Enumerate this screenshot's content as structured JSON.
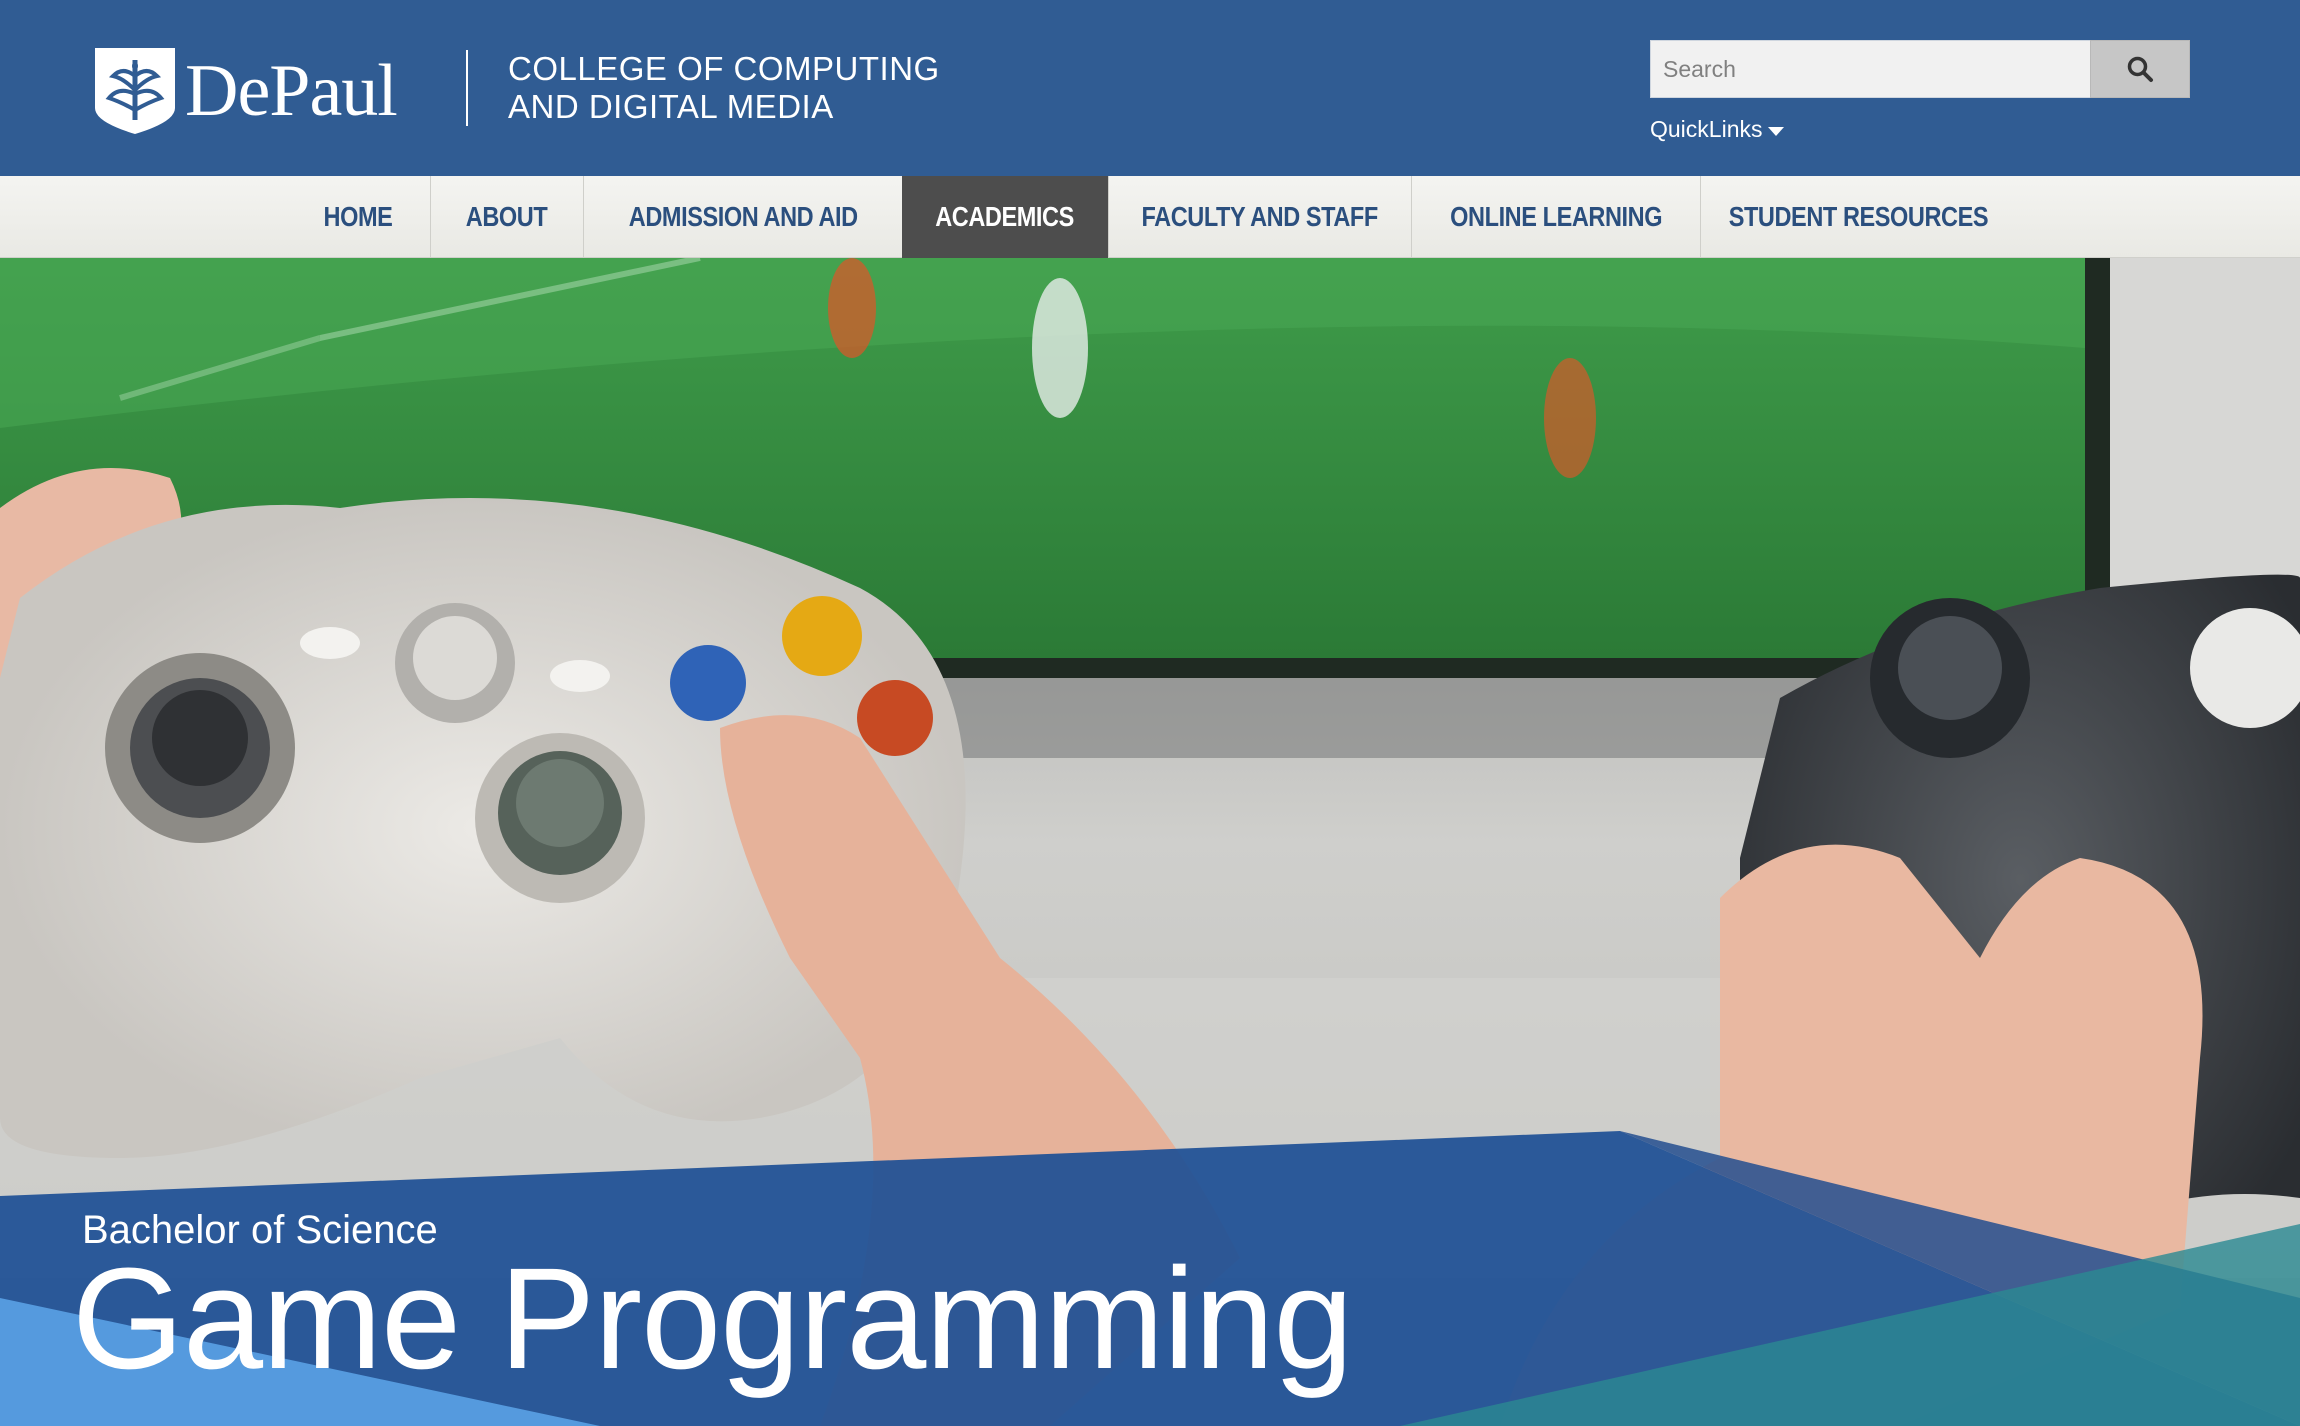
{
  "brand": {
    "logo_text": "DePaul",
    "college_line1": "COLLEGE OF COMPUTING",
    "college_line2": "AND DIGITAL MEDIA"
  },
  "search": {
    "placeholder": "Search",
    "value": "",
    "button_icon": "search-icon"
  },
  "quicklinks": {
    "label": "QuickLinks",
    "icon": "caret-down-icon"
  },
  "nav": {
    "items": [
      {
        "label": "HOME"
      },
      {
        "label": "ABOUT"
      },
      {
        "label": "ADMISSION AND AID"
      },
      {
        "label": "ACADEMICS",
        "active": true
      },
      {
        "label": "FACULTY AND STAFF"
      },
      {
        "label": "ONLINE LEARNING"
      },
      {
        "label": "STUDENT RESOURCES"
      }
    ]
  },
  "hero": {
    "degree_type": "Bachelor of Science",
    "program_title": "Game Programming"
  },
  "colors": {
    "header_bg": "#305c93",
    "nav_text": "#2b4f7e",
    "nav_active_bg": "#4d4d4d",
    "banner_blue": "#1d4f95",
    "banner_teal": "#2b8a92"
  }
}
